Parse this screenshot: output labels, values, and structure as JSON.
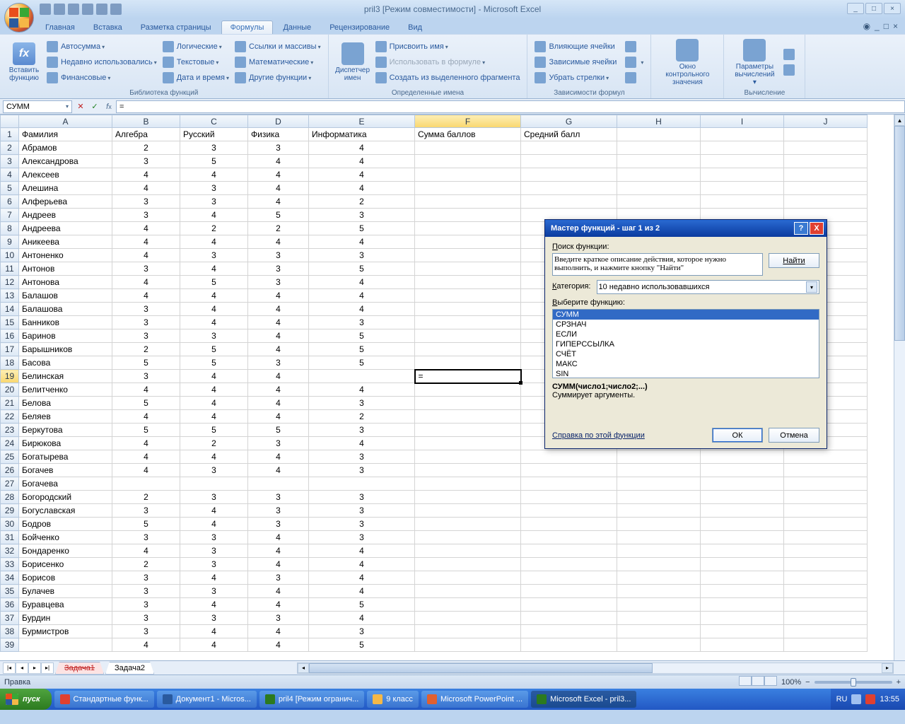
{
  "title": "pril3  [Режим совместимости] - Microsoft Excel",
  "tabs": [
    "Главная",
    "Вставка",
    "Разметка страницы",
    "Формулы",
    "Данные",
    "Рецензирование",
    "Вид"
  ],
  "active_tab": 3,
  "ribbon": {
    "g1": {
      "btn": "Вставить функцию",
      "label": "Библиотека функций",
      "col1": [
        "Автосумма",
        "Недавно использовались",
        "Финансовые"
      ],
      "col2": [
        "Логические",
        "Текстовые",
        "Дата и время"
      ],
      "col3": [
        "Ссылки и массивы",
        "Математические",
        "Другие функции"
      ]
    },
    "g2": {
      "btn": "Диспетчер имен",
      "label": "Определенные имена",
      "items": [
        "Присвоить имя",
        "Использовать в формуле",
        "Создать из выделенного фрагмента"
      ]
    },
    "g3": {
      "label": "Зависимости формул",
      "col1": [
        "Влияющие ячейки",
        "Зависимые ячейки",
        "Убрать стрелки"
      ]
    },
    "g4": {
      "btn": "Окно контрольного значения"
    },
    "g5": {
      "btn": "Параметры вычислений",
      "label": "Вычисление"
    }
  },
  "namebox": "СУММ",
  "formula": "=",
  "columns": [
    "A",
    "B",
    "C",
    "D",
    "E",
    "F",
    "G",
    "H",
    "I",
    "J"
  ],
  "header_row": [
    "Фамилия",
    "Алгебра",
    "Русский",
    "Физика",
    "Информатика",
    "Сумма баллов",
    "Средний балл"
  ],
  "rows": [
    [
      "Абрамов",
      2,
      3,
      3,
      4
    ],
    [
      "Александрова",
      3,
      5,
      4,
      4
    ],
    [
      "Алексеев",
      4,
      4,
      4,
      4
    ],
    [
      "Алешина",
      4,
      3,
      4,
      4
    ],
    [
      "Алферьева",
      3,
      3,
      4,
      2
    ],
    [
      "Андреев",
      3,
      4,
      5,
      3
    ],
    [
      "Андреева",
      4,
      2,
      2,
      5
    ],
    [
      "Аникеева",
      4,
      4,
      4,
      4
    ],
    [
      "Антоненко",
      4,
      3,
      3,
      3
    ],
    [
      "Антонов",
      3,
      4,
      3,
      5
    ],
    [
      "Антонова",
      4,
      5,
      3,
      4
    ],
    [
      "Балашов",
      4,
      4,
      4,
      4
    ],
    [
      "Балашова",
      3,
      4,
      4,
      4
    ],
    [
      "Банников",
      3,
      4,
      4,
      3
    ],
    [
      "Баринов",
      3,
      3,
      4,
      5
    ],
    [
      "Барышников",
      2,
      5,
      4,
      5
    ],
    [
      "Басова",
      5,
      5,
      3,
      5
    ],
    [
      "Белинская",
      3,
      4,
      4,
      ""
    ],
    [
      "Белитченко",
      4,
      4,
      4,
      4
    ],
    [
      "Белова",
      5,
      4,
      4,
      3
    ],
    [
      "Беляев",
      4,
      4,
      4,
      2
    ],
    [
      "Беркутова",
      5,
      5,
      5,
      3
    ],
    [
      "Бирюкова",
      4,
      2,
      3,
      4
    ],
    [
      "Богатырева",
      4,
      4,
      4,
      3
    ],
    [
      "Богачев",
      4,
      3,
      4,
      3
    ],
    [
      "Богачева",
      "",
      "",
      "",
      ""
    ],
    [
      "Богородский",
      2,
      3,
      3,
      3
    ],
    [
      "Богуславская",
      3,
      4,
      3,
      3
    ],
    [
      "Бодров",
      5,
      4,
      3,
      3
    ],
    [
      "Бойченко",
      3,
      3,
      4,
      3
    ],
    [
      "Бондаренко",
      4,
      3,
      4,
      4
    ],
    [
      "Борисенко",
      2,
      3,
      4,
      4
    ],
    [
      "Борисов",
      3,
      4,
      3,
      4
    ],
    [
      "Булачев",
      3,
      3,
      4,
      4
    ],
    [
      "Буравцева",
      3,
      4,
      4,
      5
    ],
    [
      "Бурдин",
      3,
      3,
      3,
      4
    ],
    [
      "Бурмистров",
      3,
      4,
      4,
      3
    ],
    [
      "",
      4,
      4,
      4,
      5
    ]
  ],
  "edit_cell": {
    "row": 19,
    "col": "F",
    "value": "="
  },
  "sheets": [
    "Задача1",
    "Задача2"
  ],
  "status": "Правка",
  "zoom": "100%",
  "dialog": {
    "title": "Мастер функций - шаг 1 из 2",
    "search_label": "Поиск функции:",
    "search_text": "Введите краткое описание действия, которое нужно выполнить, и нажмите кнопку \"Найти\"",
    "find": "Найти",
    "cat_label": "Категория:",
    "category": "10 недавно использовавшихся",
    "pick_label": "Выберите функцию:",
    "functions": [
      "СУММ",
      "СРЗНАЧ",
      "ЕСЛИ",
      "ГИПЕРССЫЛКА",
      "СЧЁТ",
      "МАКС",
      "SIN"
    ],
    "syntax": "СУММ(число1;число2;...)",
    "desc": "Суммирует аргументы.",
    "help": "Справка по этой функции",
    "ok": "ОК",
    "cancel": "Отмена"
  },
  "taskbar": {
    "start": "пуск",
    "items": [
      "Стандартные функ...",
      "Документ1 - Micros...",
      "pril4 [Режим огранич...",
      "9 класс",
      "Microsoft PowerPoint ...",
      "Microsoft Excel - pril3..."
    ],
    "lang": "RU",
    "time": "13:55"
  }
}
